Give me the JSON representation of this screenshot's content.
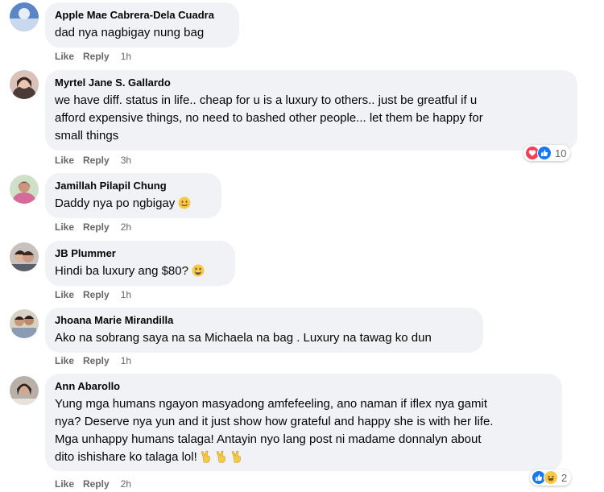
{
  "comments": [
    {
      "author": "Apple Mae Cabrera-Dela Cuadra",
      "lines": [
        "dad nya nagbigay nung bag"
      ],
      "like": "Like",
      "reply": "Reply",
      "time": "1h"
    },
    {
      "author": "Myrtel Jane S. Gallardo",
      "lines": [
        "we have diff. status in life.. cheap for u is a luxury to others.. just be greatful if u",
        "afford expensive things, no need to bashed other people... let them be happy for",
        "small things"
      ],
      "like": "Like",
      "reply": "Reply",
      "time": "3h",
      "reactions": {
        "icons": [
          "heart-icon",
          "thumbs-up-icon"
        ],
        "count": "10"
      }
    },
    {
      "author": "Jamillah Pilapil Chung",
      "lines": [
        "Daddy nya po ngbigay"
      ],
      "emoji": "smiling-face-emoji",
      "like": "Like",
      "reply": "Reply",
      "time": "2h"
    },
    {
      "author": "JB Plummer",
      "lines": [
        "Hindi ba luxury ang $80?"
      ],
      "emoji": "grinning-face-emoji",
      "like": "Like",
      "reply": "Reply",
      "time": "1h"
    },
    {
      "author": "Jhoana Marie Mirandilla",
      "lines": [
        "Ako na sobrang saya na sa Michaela na bag . Luxury na tawag ko dun"
      ],
      "like": "Like",
      "reply": "Reply",
      "time": "1h"
    },
    {
      "author": "Ann Abarollo",
      "lines": [
        "Yung mga humans ngayon masyadong amfefeeling, ano naman if iflex nya gamit",
        "nya? Deserve nya yun and it just show how grateful and happy she is with her life.",
        "Mga unhappy humans talaga! Antayin nyo lang post ni madame donnalyn about",
        "dito ishishare ko talaga lol!"
      ],
      "emoji": "victory-hand-emoji x3",
      "like": "Like",
      "reply": "Reply",
      "time": "2h",
      "reactions": {
        "icons": [
          "thumbs-up-icon",
          "laughing-face-icon"
        ],
        "count": "2"
      }
    }
  ],
  "colors": {
    "bubble": "#f0f2f5",
    "meta": "#65676b",
    "like": "#1877f2",
    "heart": "#f33e58",
    "emoji": "#f7c947"
  }
}
